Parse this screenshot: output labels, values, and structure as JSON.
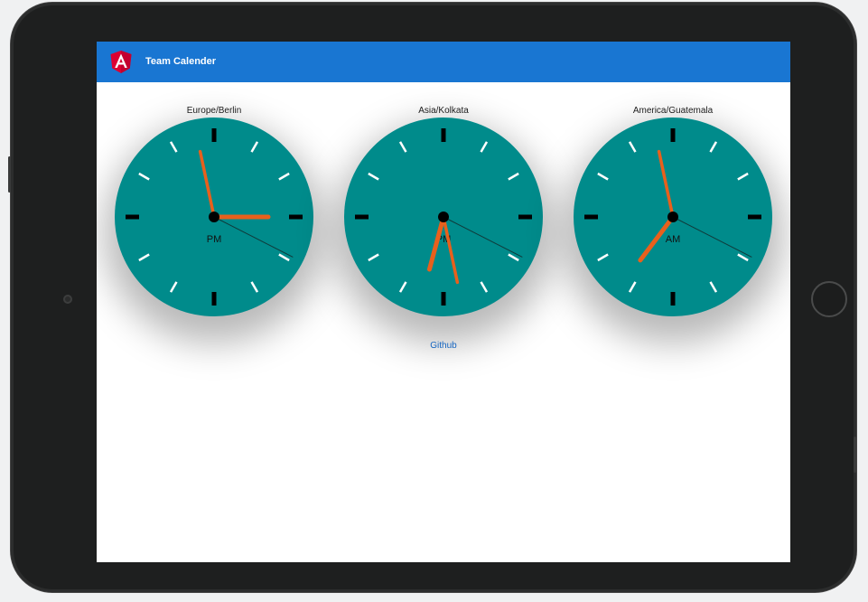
{
  "app": {
    "title": "Team Calender"
  },
  "colors": {
    "toolbar": "#1976d2",
    "clock_face": "#008b8b",
    "hand": "#e8601c",
    "link": "#1565c0"
  },
  "clocks": [
    {
      "timezone": "Europe/Berlin",
      "period": "PM",
      "hour_angle": 90,
      "minute_angle": -12,
      "second_angle": 117
    },
    {
      "timezone": "Asia/Kolkata",
      "period": "PM",
      "hour_angle": 195,
      "minute_angle": 168,
      "second_angle": 117
    },
    {
      "timezone": "America/Guatemala",
      "period": "AM",
      "hour_angle": 217,
      "minute_angle": -12,
      "second_angle": 117
    }
  ],
  "footer": {
    "link_label": "Github"
  }
}
